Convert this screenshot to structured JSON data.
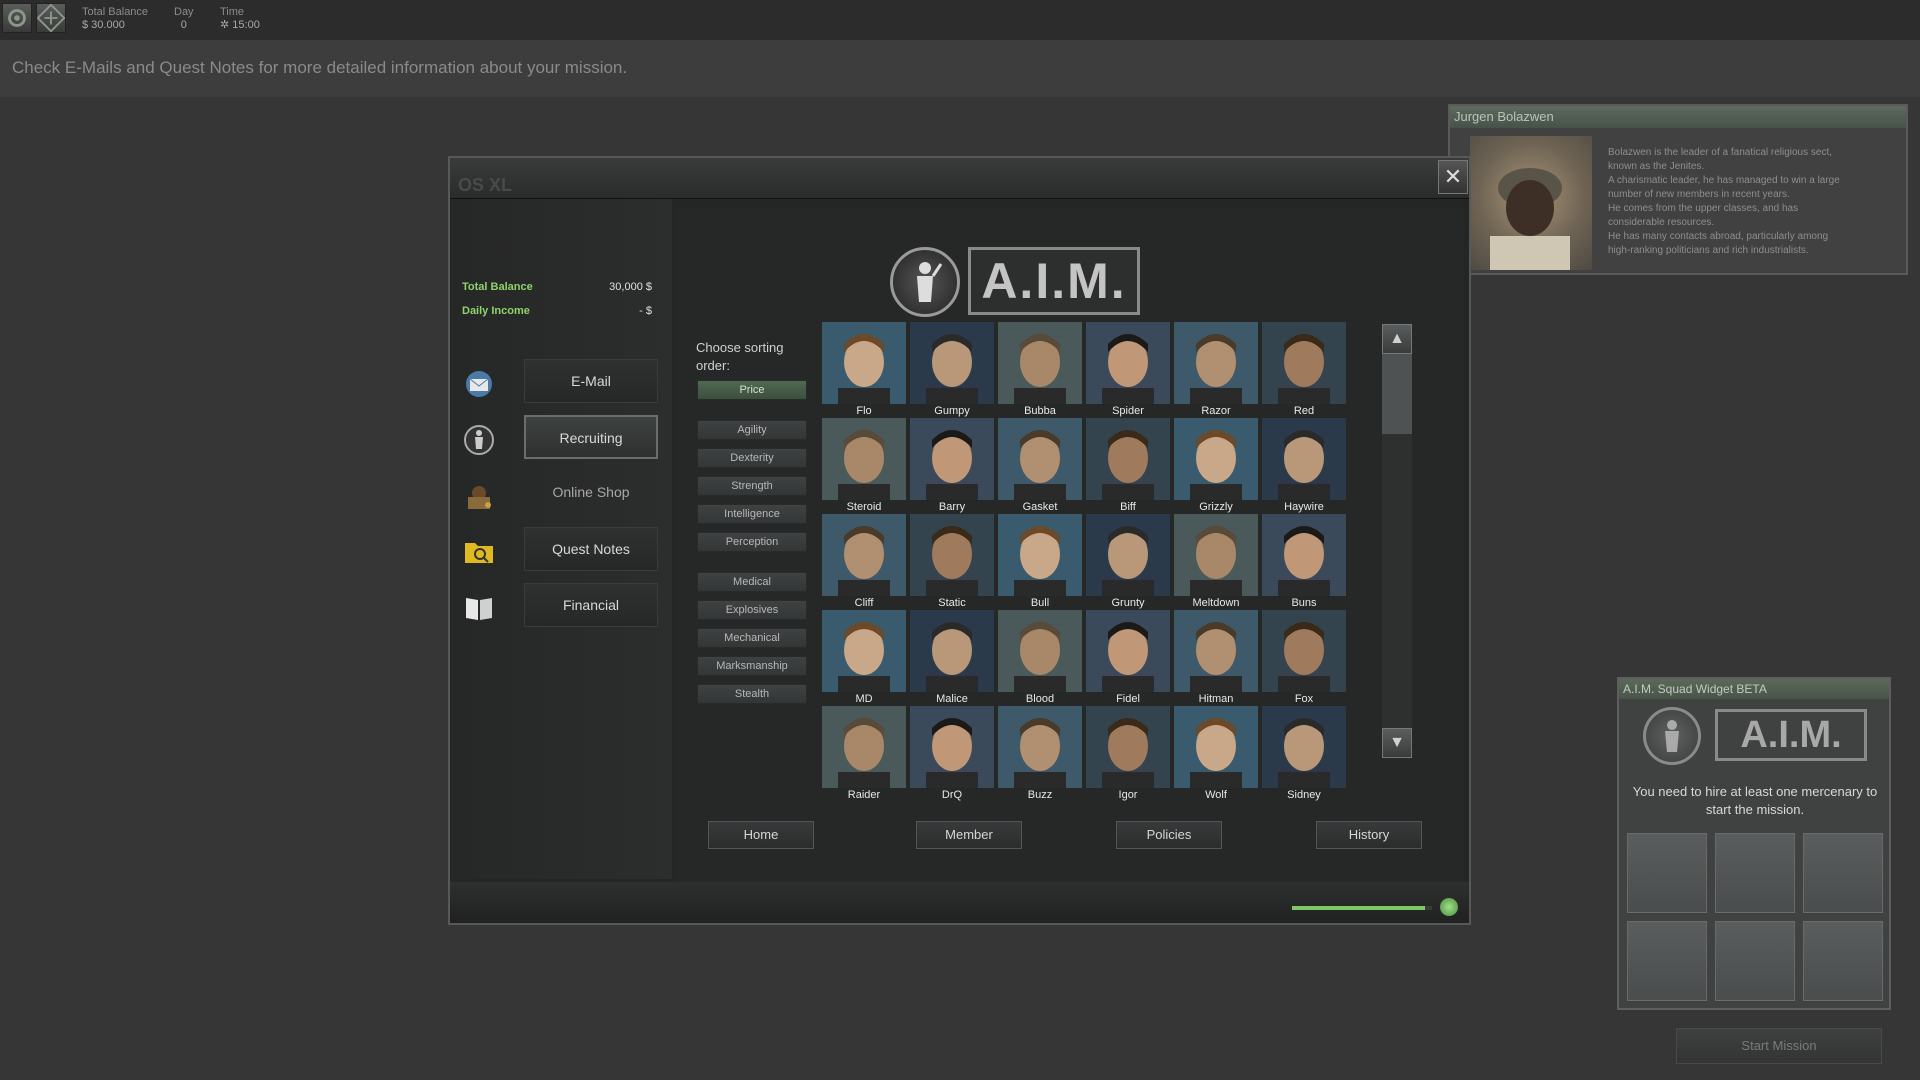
{
  "topbar": {
    "balance_label": "Total Balance",
    "balance_value": "$ 30.000",
    "day_label": "Day",
    "day_value": "0",
    "time_label": "Time",
    "time_value": "15:00"
  },
  "banner": {
    "text": "Check E-Mails and Quest Notes for more detailed information about your mission."
  },
  "info_panel": {
    "title": "Jurgen Bolazwen",
    "lines": [
      "Bolazwen is the leader of a fanatical religious sect,",
      "known as the Jenites.",
      "A charismatic leader, he has managed to win a large",
      "number of new members in recent years.",
      "He comes from the upper classes, and has",
      "considerable resources.",
      "He has many contacts abroad, particularly among",
      "high-ranking politicians and rich industrialists."
    ]
  },
  "window": {
    "title": "OS XL",
    "close_label": "✕",
    "balance_label": "Total Balance",
    "balance_value": "30,000 $",
    "income_label": "Daily Income",
    "income_value": "- $",
    "nav": [
      {
        "label": "E-Mail",
        "icon": "email-icon",
        "state": "normal"
      },
      {
        "label": "Recruiting",
        "icon": "aim-soldier-icon",
        "state": "active"
      },
      {
        "label": "Online Shop",
        "icon": "shop-icon",
        "state": "plain"
      },
      {
        "label": "Quest Notes",
        "icon": "folder-search-icon",
        "state": "normal"
      },
      {
        "label": "Financial",
        "icon": "book-icon",
        "state": "normal"
      }
    ],
    "logo_text": "A.I.M.",
    "sort_label": "Choose sorting order:",
    "sort_buttons": [
      {
        "label": "Price",
        "active": true
      },
      {
        "label": "Agility"
      },
      {
        "label": "Dexterity"
      },
      {
        "label": "Strength"
      },
      {
        "label": "Intelligence"
      },
      {
        "label": "Perception"
      },
      {
        "label": "Medical"
      },
      {
        "label": "Explosives"
      },
      {
        "label": "Mechanical"
      },
      {
        "label": "Marksmanship"
      },
      {
        "label": "Stealth"
      }
    ],
    "mercenaries": [
      [
        "Flo",
        "Gumpy",
        "Bubba",
        "Spider",
        "Razor",
        "Red"
      ],
      [
        "Steroid",
        "Barry",
        "Gasket",
        "Biff",
        "Grizzly",
        "Haywire"
      ],
      [
        "Cliff",
        "Static",
        "Bull",
        "Grunty",
        "Meltdown",
        "Buns"
      ],
      [
        "MD",
        "Malice",
        "Blood",
        "Fidel",
        "Hitman",
        "Fox"
      ],
      [
        "Raider",
        "DrQ",
        "Buzz",
        "Igor",
        "Wolf",
        "Sidney"
      ]
    ],
    "tabs": [
      "Home",
      "Member",
      "Policies",
      "History"
    ],
    "progress": 0.95,
    "colors": {
      "accent_green": "#8fd36a",
      "active_sort": "#506a52"
    }
  },
  "squad_widget": {
    "title": "A.I.M. Squad Widget BETA",
    "logo_text": "A.I.M.",
    "message": "You need to hire at least one mercenary to start the mission.",
    "slot_count": 6,
    "start_label": "Start Mission"
  }
}
